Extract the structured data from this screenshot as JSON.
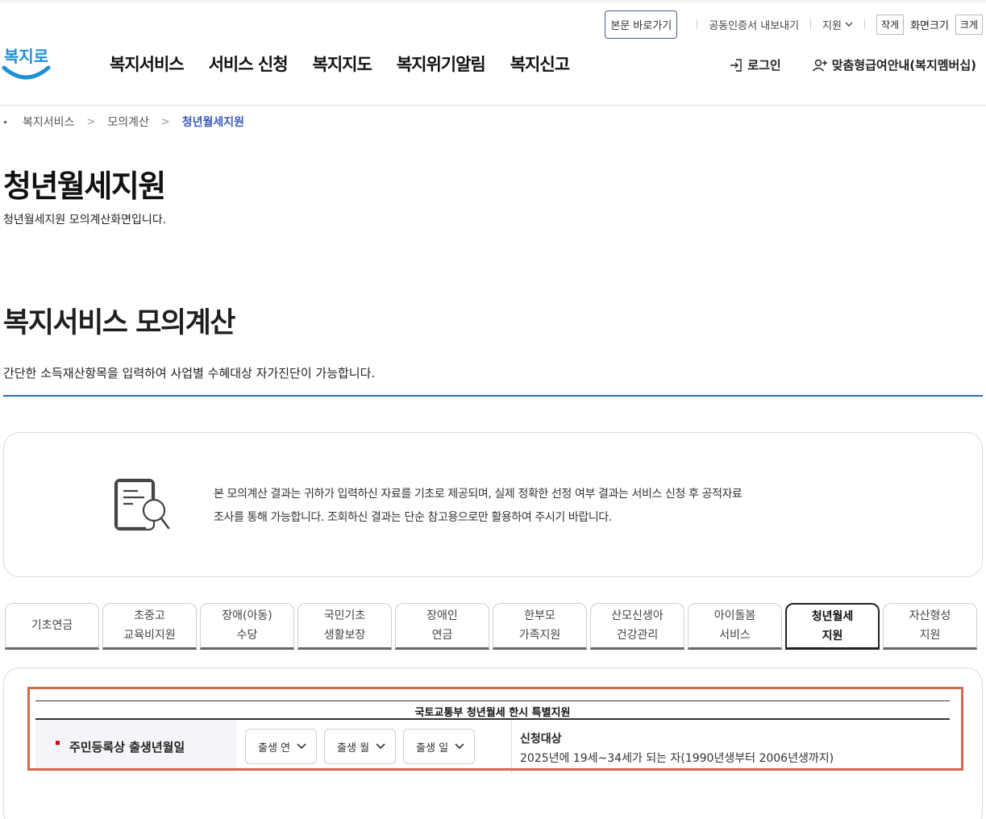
{
  "utility": {
    "skip_to_content": "본문 바로가기",
    "cert_export": "공동인증서 내보내기",
    "lang": "지원",
    "font_small": "작게",
    "font_label": "화면크기",
    "font_large": "크게"
  },
  "logo": {
    "text": "복지로"
  },
  "nav": {
    "items": [
      "복지서비스",
      "서비스 신청",
      "복지지도",
      "복지위기알림",
      "복지신고"
    ]
  },
  "member": {
    "login": "로그인",
    "guide": "맞춤형급여안내(복지멤버십)"
  },
  "breadcrumb": [
    "복지서비스",
    "모의계산",
    "청년월세지원"
  ],
  "page": {
    "title": "청년월세지원",
    "desc": "청년월세지원 모의계산화면입니다."
  },
  "section": {
    "title": "복지서비스 모의계산",
    "desc": "간단한 소득재산항목을 입력하여 사업별 수혜대상 자가진단이 가능합니다."
  },
  "notice": {
    "line1": "본 모의계산 결과는 귀하가 입력하신 자료를 기초로 제공되며, 실제 정확한 선정 여부 결과는 서비스 신청 후 공적자료",
    "line2": "조사를 통해 가능합니다. 조회하신 결과는 단순 참고용으로만 활용하여 주시기 바랍니다."
  },
  "tabs": [
    {
      "line1": "기초연금",
      "line2": "",
      "active": false
    },
    {
      "line1": "초중고",
      "line2": "교육비지원",
      "active": false
    },
    {
      "line1": "장애(아동)",
      "line2": "수당",
      "active": false
    },
    {
      "line1": "국민기초",
      "line2": "생활보장",
      "active": false
    },
    {
      "line1": "장애인",
      "line2": "연금",
      "active": false
    },
    {
      "line1": "한부모",
      "line2": "가족지원",
      "active": false
    },
    {
      "line1": "산모신생아",
      "line2": "건강관리",
      "active": false
    },
    {
      "line1": "아이돌봄",
      "line2": "서비스",
      "active": false
    },
    {
      "line1": "청년월세",
      "line2": "지원",
      "active": true
    },
    {
      "line1": "자산형성",
      "line2": "지원",
      "active": false
    }
  ],
  "form": {
    "caption": "국토교통부 청년월세 한시 특별지원",
    "birth_label": "주민등록상 출생년월일",
    "year_select": "출생 연",
    "month_select": "출생 월",
    "day_select": "출생 일",
    "target_title": "신청대상",
    "target_desc": "2025년에 19세~34세가 되는 자(1990년생부터 2006년생까지)"
  },
  "colors": {
    "accent_blue": "#2a6bb0",
    "breadcrumb_current": "#3a5bb8",
    "highlight_border": "#d06a4e",
    "required_mark": "#e60012"
  }
}
